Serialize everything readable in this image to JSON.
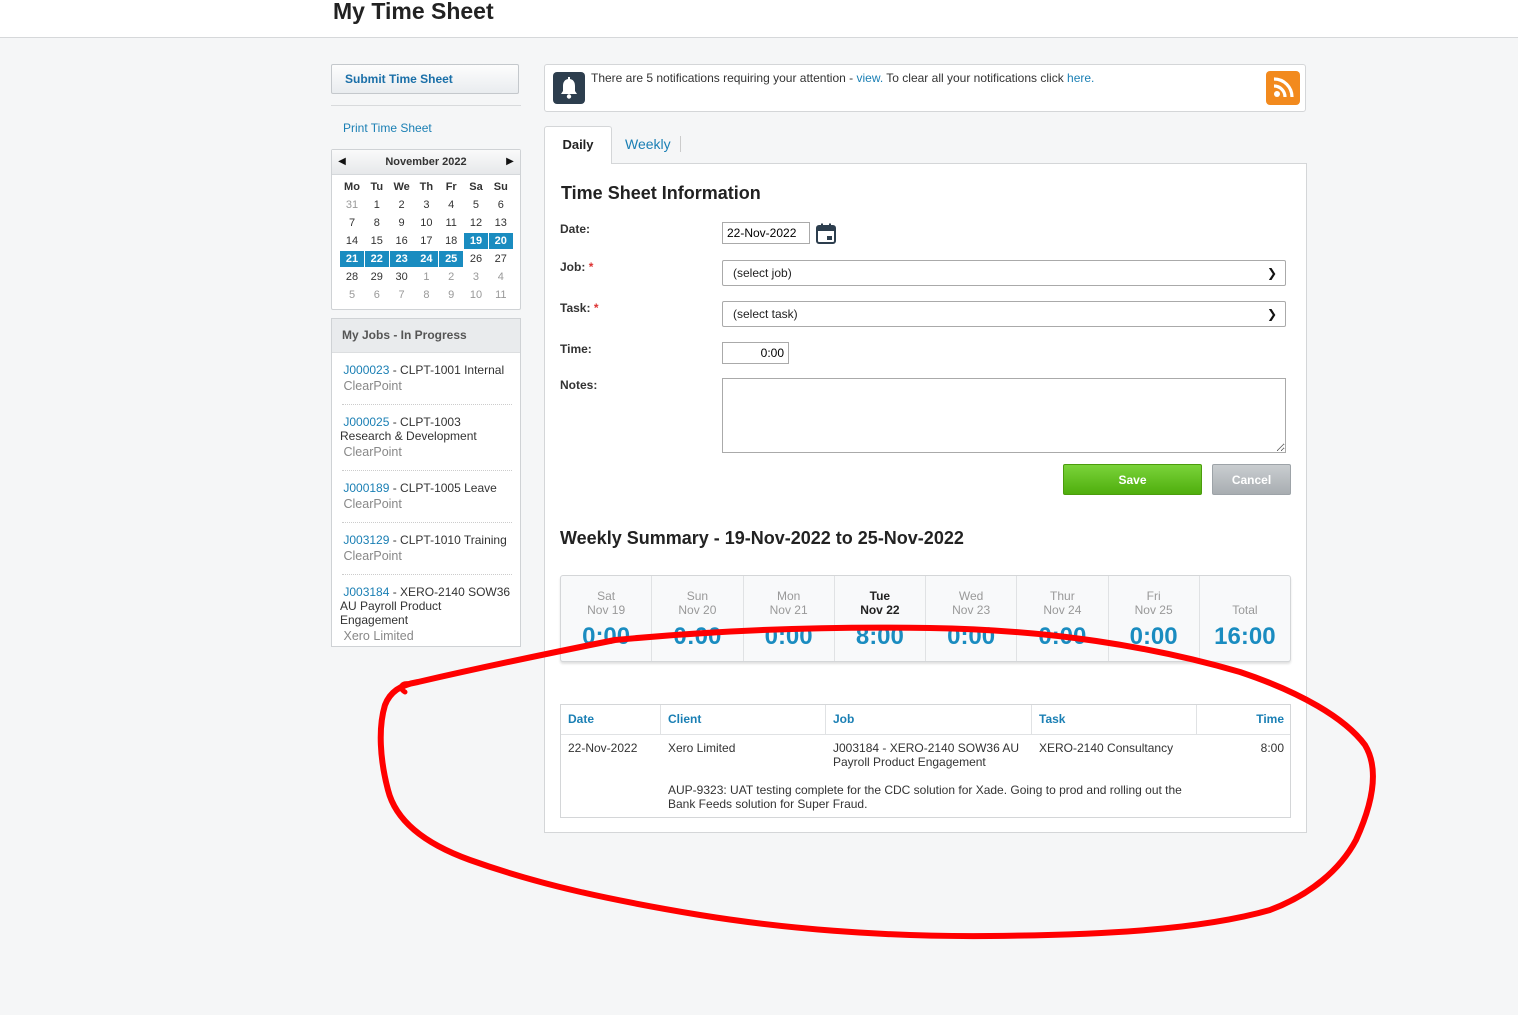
{
  "header": {
    "title": "My Time Sheet"
  },
  "sidebar": {
    "submit_label": "Submit Time Sheet",
    "print_label": "Print Time Sheet",
    "calendar": {
      "month": "November 2022",
      "dow": [
        "Mo",
        "Tu",
        "We",
        "Th",
        "Fr",
        "Sa",
        "Su"
      ],
      "weeks": [
        [
          {
            "d": "31",
            "t": "other"
          },
          {
            "d": "1"
          },
          {
            "d": "2"
          },
          {
            "d": "3"
          },
          {
            "d": "4"
          },
          {
            "d": "5"
          },
          {
            "d": "6"
          }
        ],
        [
          {
            "d": "7"
          },
          {
            "d": "8"
          },
          {
            "d": "9"
          },
          {
            "d": "10"
          },
          {
            "d": "11"
          },
          {
            "d": "12"
          },
          {
            "d": "13"
          }
        ],
        [
          {
            "d": "14"
          },
          {
            "d": "15"
          },
          {
            "d": "16"
          },
          {
            "d": "17"
          },
          {
            "d": "18"
          },
          {
            "d": "19",
            "t": "sel"
          },
          {
            "d": "20",
            "t": "sel"
          }
        ],
        [
          {
            "d": "21",
            "t": "sel"
          },
          {
            "d": "22",
            "t": "sel"
          },
          {
            "d": "23",
            "t": "sel"
          },
          {
            "d": "24",
            "t": "sel"
          },
          {
            "d": "25",
            "t": "sel"
          },
          {
            "d": "26"
          },
          {
            "d": "27"
          }
        ],
        [
          {
            "d": "28"
          },
          {
            "d": "29"
          },
          {
            "d": "30"
          },
          {
            "d": "1",
            "t": "other"
          },
          {
            "d": "2",
            "t": "other"
          },
          {
            "d": "3",
            "t": "other"
          },
          {
            "d": "4",
            "t": "other"
          }
        ],
        [
          {
            "d": "5",
            "t": "other"
          },
          {
            "d": "6",
            "t": "other"
          },
          {
            "d": "7",
            "t": "other"
          },
          {
            "d": "8",
            "t": "other"
          },
          {
            "d": "9",
            "t": "other"
          },
          {
            "d": "10",
            "t": "other"
          },
          {
            "d": "11",
            "t": "other"
          }
        ]
      ]
    },
    "jobs_title": "My Jobs - In Progress",
    "jobs": [
      {
        "code": "J000023",
        "desc": " - CLPT-1001 Internal",
        "client": "ClearPoint"
      },
      {
        "code": "J000025",
        "desc": " - CLPT-1003 Research & Development",
        "client": "ClearPoint"
      },
      {
        "code": "J000189",
        "desc": " - CLPT-1005 Leave",
        "client": "ClearPoint"
      },
      {
        "code": "J003129",
        "desc": " - CLPT-1010 Training",
        "client": "ClearPoint"
      },
      {
        "code": "J003184",
        "desc": " - XERO-2140 SOW36 AU Payroll Product Engagement",
        "client": "Xero Limited"
      }
    ]
  },
  "notification": {
    "text_before": "There are 5 notifications requiring your attention - ",
    "view_link": "view.",
    "text_middle": " To clear all your notifications click ",
    "here_link": "here."
  },
  "tabs": {
    "daily": "Daily",
    "weekly": "Weekly"
  },
  "form": {
    "title": "Time Sheet Information",
    "date_label": "Date:",
    "date_value": "22-Nov-2022",
    "job_label": "Job:",
    "job_value": "(select job)",
    "task_label": "Task:",
    "task_value": "(select task)",
    "required_mark": "*",
    "time_label": "Time:",
    "time_value": "0:00",
    "notes_label": "Notes:",
    "save_label": "Save",
    "cancel_label": "Cancel"
  },
  "summary": {
    "title": "Weekly Summary - 19-Nov-2022 to 25-Nov-2022",
    "days": [
      {
        "name": "Sat",
        "date": "Nov 19",
        "time": "0:00"
      },
      {
        "name": "Sun",
        "date": "Nov 20",
        "time": "0:00"
      },
      {
        "name": "Mon",
        "date": "Nov 21",
        "time": "0:00"
      },
      {
        "name": "Tue",
        "date": "Nov 22",
        "time": "8:00",
        "current": true
      },
      {
        "name": "Wed",
        "date": "Nov 23",
        "time": "0:00"
      },
      {
        "name": "Thur",
        "date": "Nov 24",
        "time": "0:00"
      },
      {
        "name": "Fri",
        "date": "Nov 25",
        "time": "0:00"
      }
    ],
    "total_label": "Total",
    "total_time": "16:00"
  },
  "entries": {
    "headers": {
      "date": "Date",
      "client": "Client",
      "job": "Job",
      "task": "Task",
      "time": "Time"
    },
    "rows": [
      {
        "date": "22-Nov-2022",
        "client": "Xero Limited",
        "job": "J003184 - XERO-2140 SOW36 AU Payroll Product Engagement",
        "task": "XERO-2140 Consultancy",
        "time": "8:00",
        "note": "AUP-9323: UAT testing complete for the CDC solution for Xade. Going to prod and rolling out the Bank Feeds solution for Super Fraud."
      }
    ]
  },
  "colors": {
    "accent": "#1a8cc0",
    "save": "#5cb91c",
    "annotation": "#ff0000",
    "rss": "#f28a1e"
  }
}
